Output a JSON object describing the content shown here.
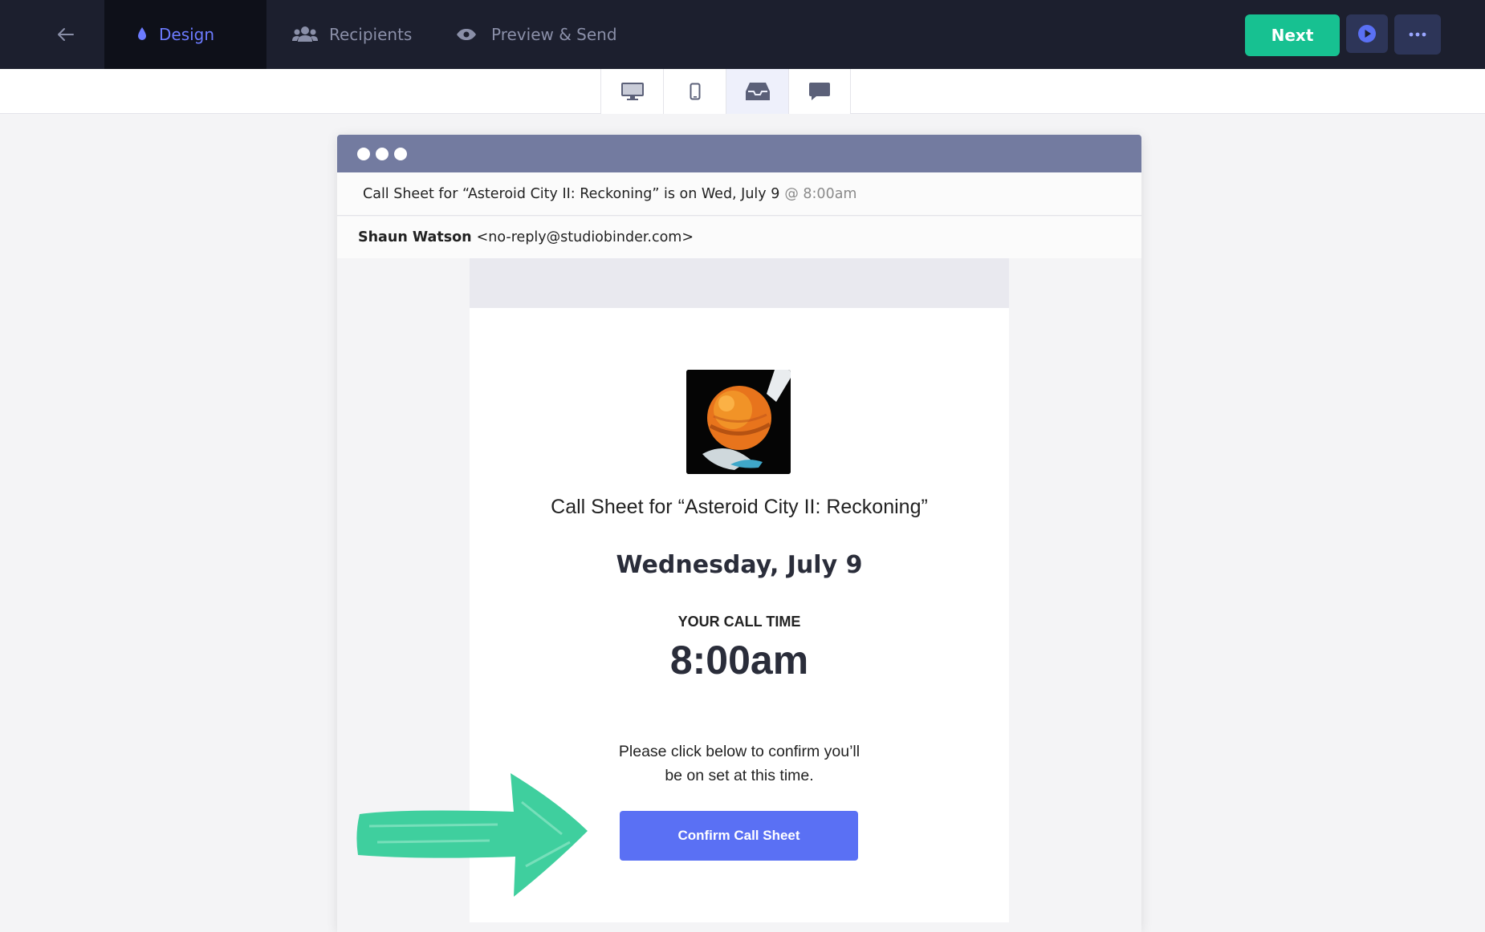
{
  "topbar": {
    "tabs": [
      {
        "label": "Design",
        "icon": "droplet-icon",
        "active": true
      },
      {
        "label": "Recipients",
        "icon": "users-icon",
        "active": false
      },
      {
        "label": "Preview & Send",
        "icon": "eye-icon",
        "active": false
      }
    ],
    "next_label": "Next",
    "colors": {
      "bar": "#1c1f2e",
      "active_tab": "#0e1019",
      "accent": "#6c7bff",
      "next": "#17c191"
    }
  },
  "view_switcher": {
    "active": "inbox",
    "views": [
      "desktop-icon",
      "mobile-icon",
      "inbox-icon",
      "sms-icon"
    ]
  },
  "email": {
    "subject": "Call Sheet for “Asteroid City II: Reckoning” is on Wed, July 9",
    "subject_time": "@ 8:00am",
    "sender_name": "Shaun Watson",
    "sender_email": "<no-reply@studiobinder.com>",
    "title": "Call Sheet for “Asteroid City II: Reckoning”",
    "date": "Wednesday, July 9",
    "call_time_label": "YOUR CALL TIME",
    "call_time": "8:00am",
    "confirm_line1": "Please click below to confirm you’ll",
    "confirm_line2": "be on set at this time.",
    "confirm_button": "Confirm Call Sheet",
    "button_color": "#5a70f4",
    "annotation": "green-arrow"
  }
}
